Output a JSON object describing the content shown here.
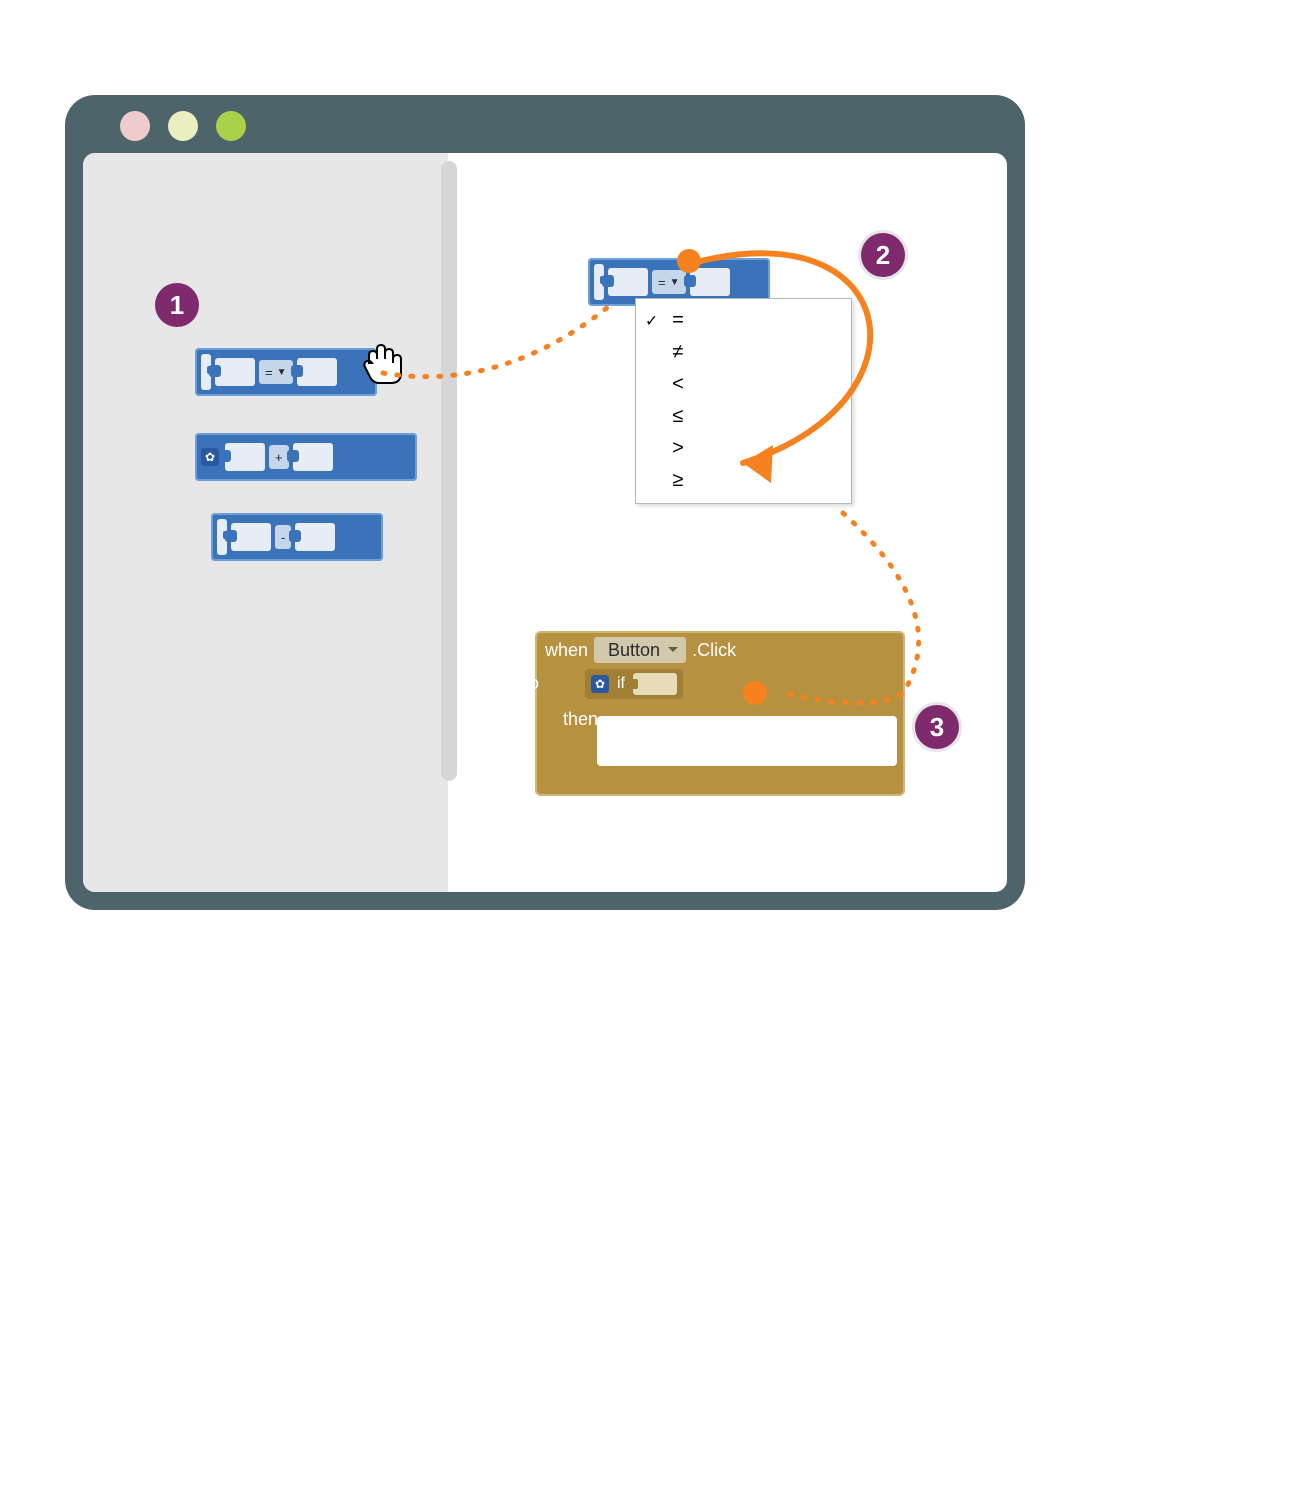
{
  "steps": {
    "s1": "1",
    "s2": "2",
    "s3": "3"
  },
  "palette": {
    "compare_op": "=",
    "math_op": "+",
    "math2_op": "-"
  },
  "dragged_op": "=",
  "dropdown": {
    "items": [
      "=",
      "≠",
      "<",
      "≤",
      ">",
      "≥"
    ],
    "selected_index": 0,
    "target_index": 4
  },
  "event_block": {
    "when": "when",
    "component": "Button",
    "event": ".Click",
    "do": "do",
    "if": "if",
    "then": "then"
  },
  "colors": {
    "window": "#4d646b",
    "badge": "#7e2a6c",
    "block_blue": "#3a73b9",
    "block_gold": "#b6913f",
    "orange": "#f5821f"
  }
}
